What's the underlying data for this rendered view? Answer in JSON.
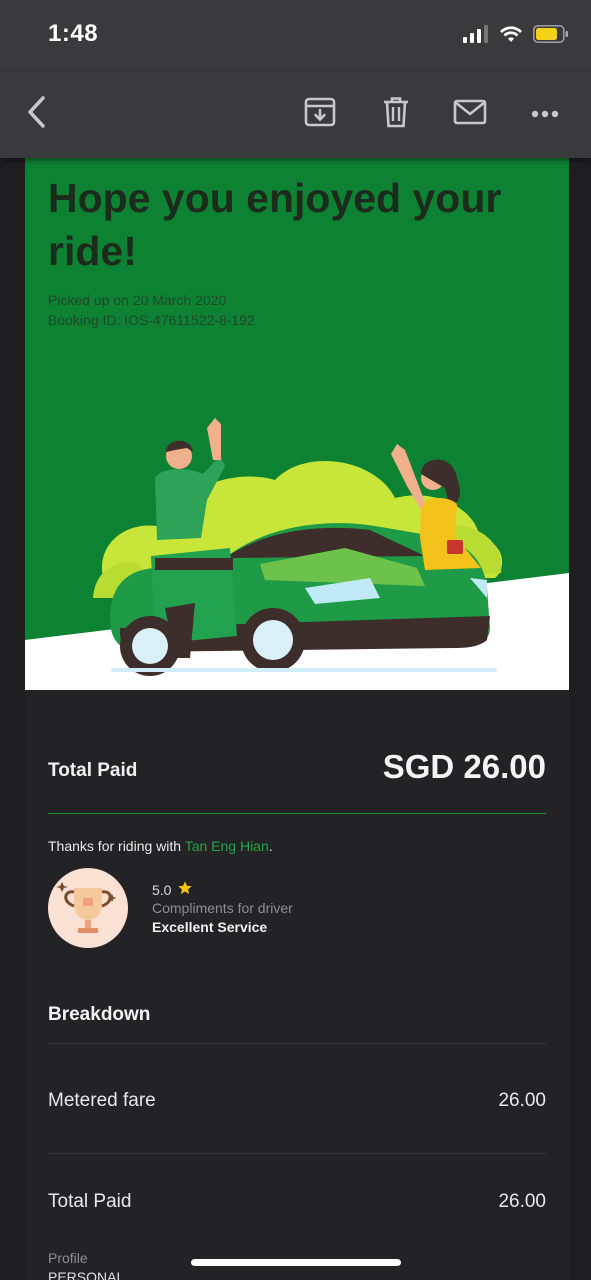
{
  "status_bar": {
    "time": "1:48"
  },
  "toolbar": {
    "back_icon": "chevron-left-icon",
    "archive_icon": "archive-icon",
    "delete_icon": "trash-icon",
    "mail_icon": "envelope-icon",
    "more_icon": "more-horizontal-icon"
  },
  "hero": {
    "title": "Hope you enjoyed your ride!",
    "pickup": "Picked up on 20 March 2020",
    "booking": "Booking ID: IOS-47611522-8-192"
  },
  "payment": {
    "total_label": "Total Paid",
    "total_amount": "SGD 26.00"
  },
  "driver": {
    "thanks_prefix": "Thanks for riding with ",
    "name": "Tan Eng Hian",
    "thanks_suffix": ".",
    "rating": "5.0",
    "compliment_label": "Compliments for driver",
    "compliment": "Excellent Service"
  },
  "breakdown": {
    "heading": "Breakdown",
    "rows": [
      {
        "label": "Metered fare",
        "value": "26.00"
      },
      {
        "label": "Total Paid",
        "value": "26.00"
      }
    ]
  },
  "profile": {
    "label": "Profile",
    "value": "PERSONAL"
  },
  "colors": {
    "brand_green": "#0e8233",
    "link_green": "#26a24b",
    "star": "#f5c518"
  }
}
